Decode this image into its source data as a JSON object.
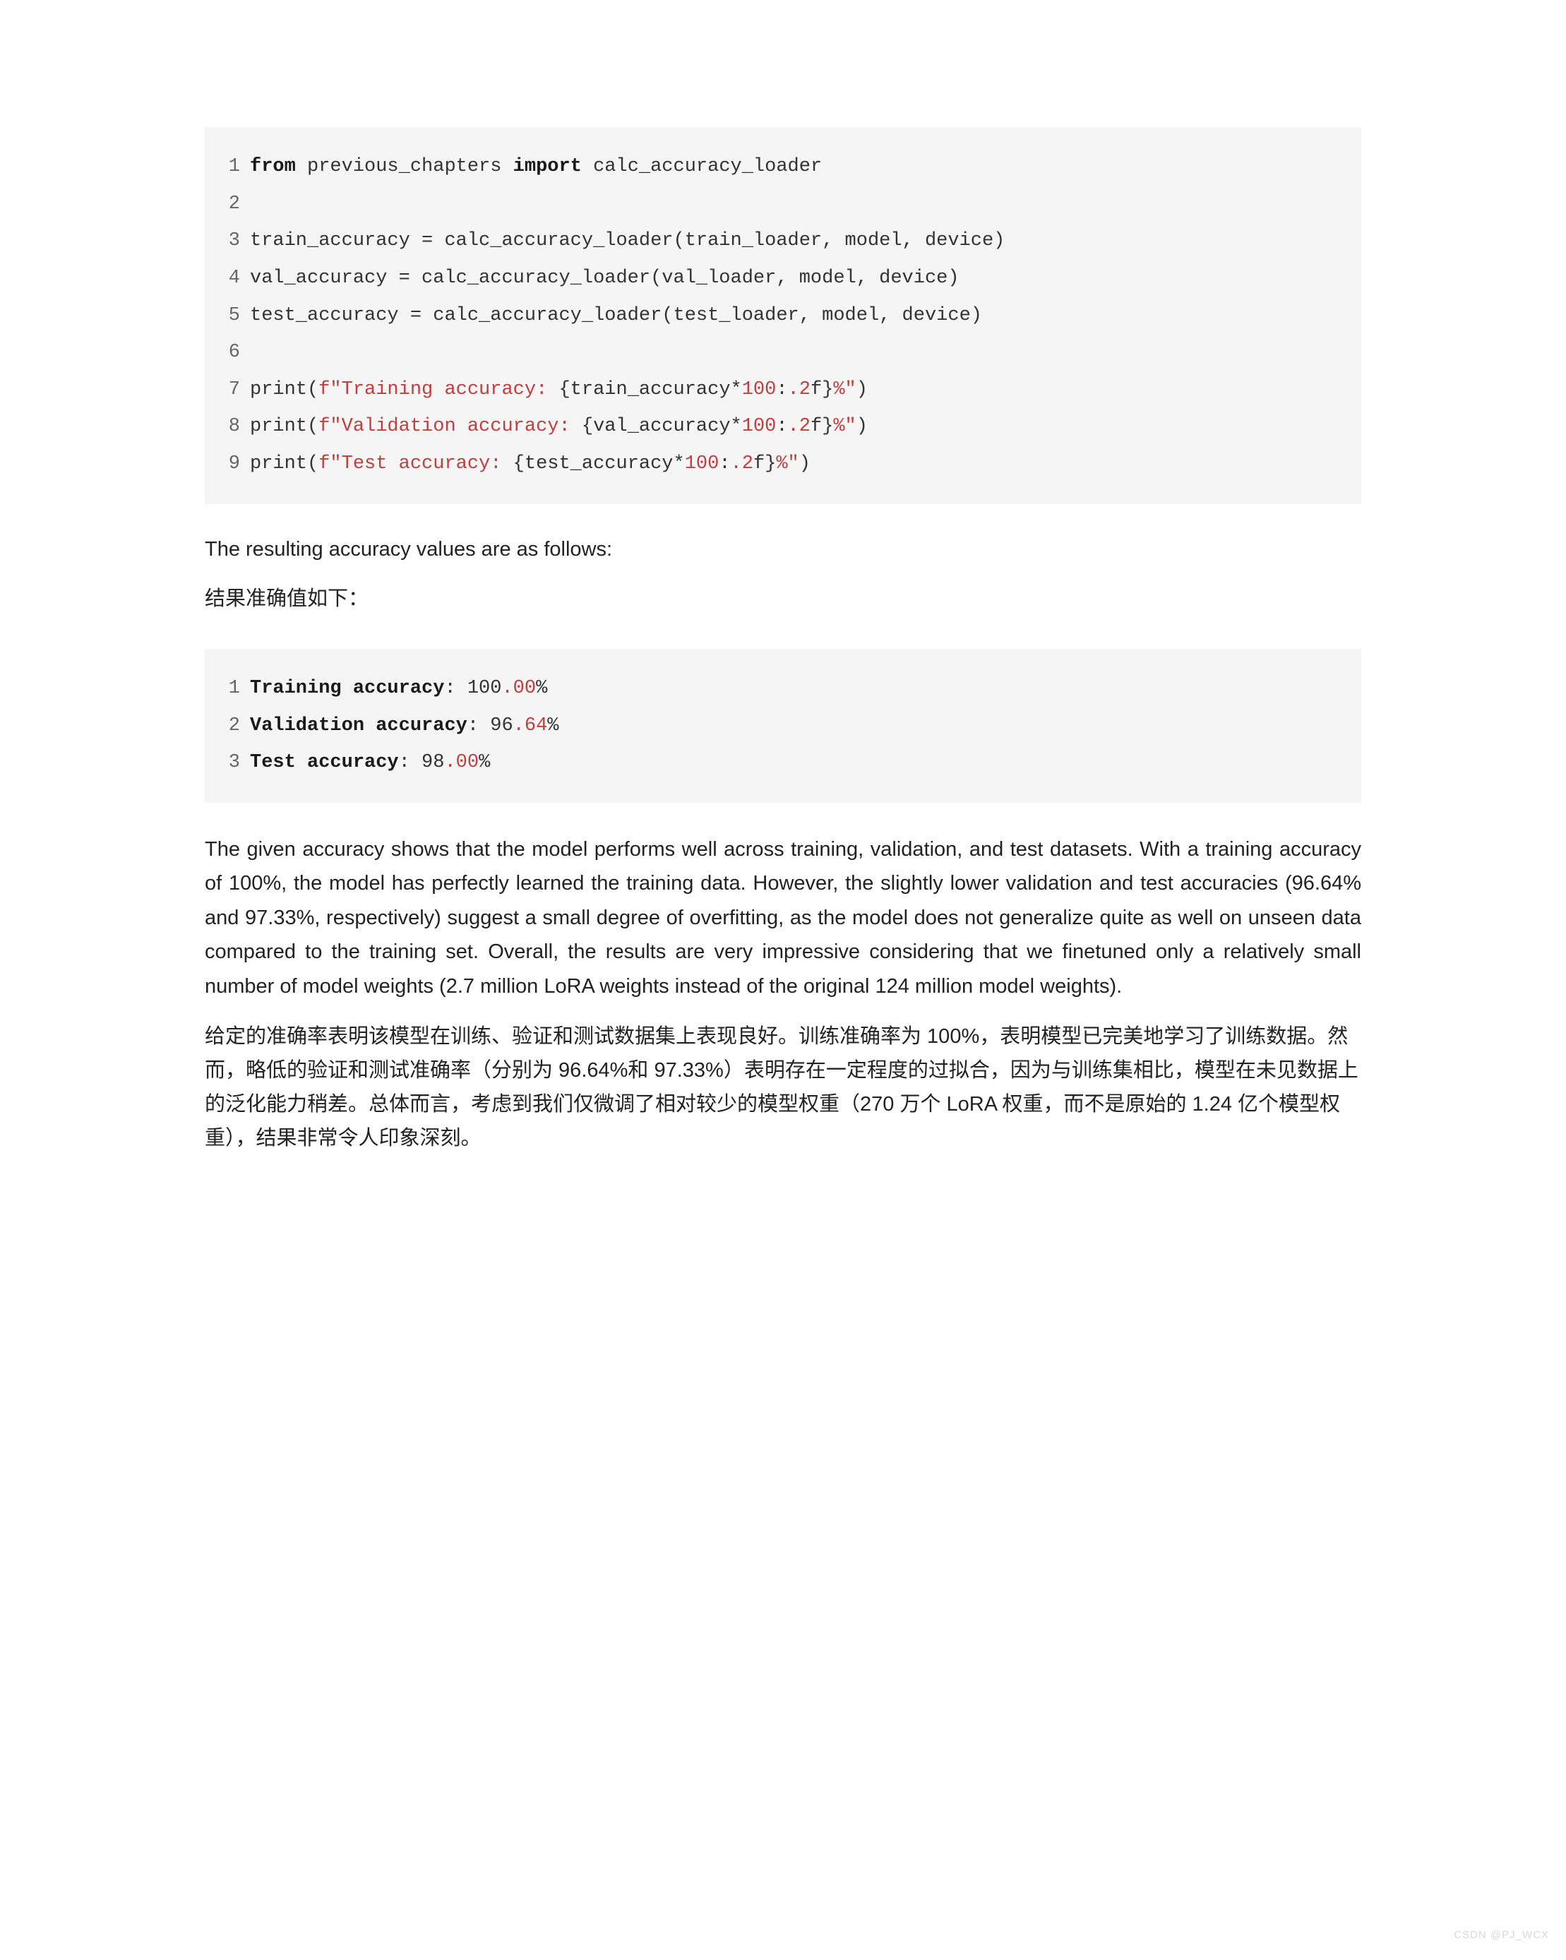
{
  "code1": {
    "lines": [
      {
        "n": "1",
        "html": "<span class=\"kw\">from</span> previous_chapters <span class=\"kw\">import</span> calc_accuracy_loader"
      },
      {
        "n": "2",
        "html": ""
      },
      {
        "n": "3",
        "html": "train_accuracy = calc_accuracy_loader(train_loader, model, device)"
      },
      {
        "n": "4",
        "html": "val_accuracy = calc_accuracy_loader(val_loader, model, device)"
      },
      {
        "n": "5",
        "html": "test_accuracy = calc_accuracy_loader(test_loader, model, device)"
      },
      {
        "n": "6",
        "html": ""
      },
      {
        "n": "7",
        "html": "print(<span class=\"str\">f\"Training accuracy: </span>{train_accuracy*<span class=\"num\">100</span>:<span class=\"num\">.2</span>f}<span class=\"str\">%\"</span>)"
      },
      {
        "n": "8",
        "html": "print(<span class=\"str\">f\"Validation accuracy: </span>{val_accuracy*<span class=\"num\">100</span>:<span class=\"num\">.2</span>f}<span class=\"str\">%\"</span>)"
      },
      {
        "n": "9",
        "html": "print(<span class=\"str\">f\"Test accuracy: </span>{test_accuracy*<span class=\"num\">100</span>:<span class=\"num\">.2</span>f}<span class=\"str\">%\"</span>)"
      }
    ]
  },
  "para1_en": "The resulting accuracy values are as follows:",
  "para1_cn": "结果准确值如下：",
  "code2": {
    "lines": [
      {
        "n": "1",
        "html": "<span class=\"kw\">Training accuracy</span>: 100<span class=\"op\">.00</span>%"
      },
      {
        "n": "2",
        "html": "<span class=\"kw\">Validation accuracy</span>: 96<span class=\"op\">.64</span>%"
      },
      {
        "n": "3",
        "html": "<span class=\"kw\">Test accuracy</span>: 98<span class=\"op\">.00</span>%"
      }
    ]
  },
  "para2_en": "The given accuracy shows that the model performs well across training, validation, and test datasets. With a training accuracy of 100%, the model has perfectly learned the training data. However, the slightly lower validation and test accuracies (96.64% and 97.33%, respectively) suggest a small degree of overfitting, as the model does not generalize quite as well on unseen data compared to the training set. Overall, the results are very impressive considering that we finetuned only a relatively small number of model weights (2.7 million LoRA weights instead of the original 124 million model weights).",
  "para2_cn": "给定的准确率表明该模型在训练、验证和测试数据集上表现良好。训练准确率为 100%，表明模型已完美地学习了训练数据。然而，略低的验证和测试准确率（分别为 96.64%和 97.33%）表明存在一定程度的过拟合，因为与训练集相比，模型在未见数据上的泛化能力稍差。总体而言，考虑到我们仅微调了相对较少的模型权重（270 万个 LoRA 权重，而不是原始的 1.24 亿个模型权重），结果非常令人印象深刻。",
  "watermark": "CSDN @PJ_WCX"
}
